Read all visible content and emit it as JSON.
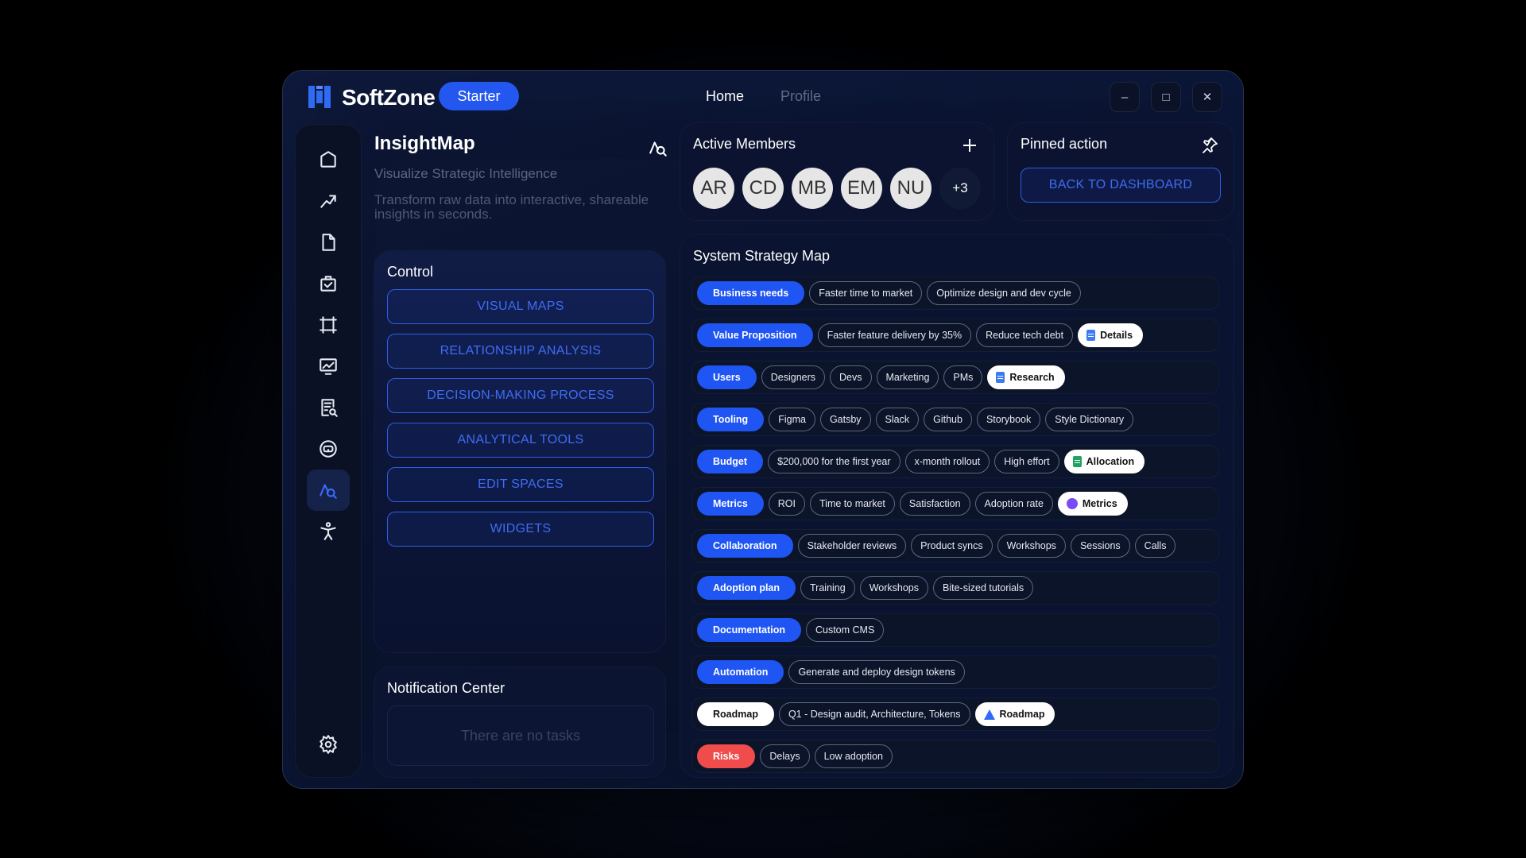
{
  "app": {
    "name": "SoftZone",
    "plan": "Starter"
  },
  "nav": [
    {
      "label": "Home"
    },
    {
      "label": "Profile"
    }
  ],
  "window_controls": {
    "minimize": "–",
    "maximize": "□",
    "close": "✕"
  },
  "sidebar": {
    "items": [
      {
        "icon": "home-icon"
      },
      {
        "icon": "trend-icon"
      },
      {
        "icon": "document-icon"
      },
      {
        "icon": "task-check-icon"
      },
      {
        "icon": "frame-icon"
      },
      {
        "icon": "monitor-chart-icon"
      },
      {
        "icon": "report-search-icon"
      },
      {
        "icon": "vr-icon"
      },
      {
        "icon": "insight-map-icon",
        "active": true
      },
      {
        "icon": "accessibility-icon"
      },
      {
        "icon": "settings-icon"
      }
    ]
  },
  "insight": {
    "title": "InsightMap",
    "subtitle": "Visualize Strategic Intelligence",
    "description": "Transform raw data into interactive, shareable insights in seconds."
  },
  "control": {
    "title": "Control",
    "buttons": [
      "VISUAL MAPS",
      "RELATIONSHIP ANALYSIS",
      "DECISION-MAKING PROCESS",
      "ANALYTICAL TOOLS",
      "EDIT SPACES",
      "WIDGETS"
    ]
  },
  "notifications": {
    "title": "Notification Center",
    "empty": "There are no tasks"
  },
  "members": {
    "title": "Active Members",
    "avatars": [
      "AR",
      "CD",
      "MB",
      "EM",
      "NU"
    ],
    "more": "+3"
  },
  "pinned": {
    "title": "Pinned action",
    "button": "BACK TO DASHBOARD"
  },
  "strategy": {
    "title": "System Strategy Map",
    "rows": [
      {
        "head": "Business needs",
        "chips": [
          "Faster time to market",
          "Optimize design and dev cycle"
        ]
      },
      {
        "head": "Value Proposition",
        "chips": [
          "Faster feature delivery by 35%",
          "Reduce tech debt"
        ],
        "doc": {
          "label": "Details",
          "icon": "doc-blue"
        }
      },
      {
        "head": "Users",
        "chips": [
          "Designers",
          "Devs",
          "Marketing",
          "PMs"
        ],
        "doc": {
          "label": "Research",
          "icon": "doc-blue"
        }
      },
      {
        "head": "Tooling",
        "chips": [
          "Figma",
          "Gatsby",
          "Slack",
          "Github",
          "Storybook",
          "Style Dictionary"
        ]
      },
      {
        "head": "Budget",
        "chips": [
          "$200,000 for the first year",
          "x-month rollout",
          "High effort"
        ],
        "doc": {
          "label": "Allocation",
          "icon": "doc-green"
        }
      },
      {
        "head": "Metrics",
        "chips": [
          "ROI",
          "Time to market",
          "Satisfaction",
          "Adoption rate"
        ],
        "doc": {
          "label": "Metrics",
          "icon": "circle-purple"
        }
      },
      {
        "head": "Collaboration",
        "chips": [
          "Stakeholder reviews",
          "Product syncs",
          "Workshops",
          "Sessions",
          "Calls"
        ]
      },
      {
        "head": "Adoption plan",
        "chips": [
          "Training",
          "Workshops",
          "Bite-sized tutorials"
        ]
      },
      {
        "head": "Documentation",
        "chips": [
          "Custom CMS"
        ]
      },
      {
        "head": "Automation",
        "chips": [
          "Generate and deploy design tokens"
        ]
      },
      {
        "head": "Roadmap",
        "style": "white",
        "chips": [
          "Q1 - Design audit, Architecture, Tokens"
        ],
        "doc": {
          "label": "Roadmap",
          "icon": "triangle-blue"
        }
      },
      {
        "head": "Risks",
        "style": "red",
        "chips": [
          "Delays",
          "Low adoption"
        ]
      }
    ]
  },
  "colors": {
    "accent": "#1f55f2",
    "danger": "#f04c4c",
    "background": "#0a1330"
  }
}
